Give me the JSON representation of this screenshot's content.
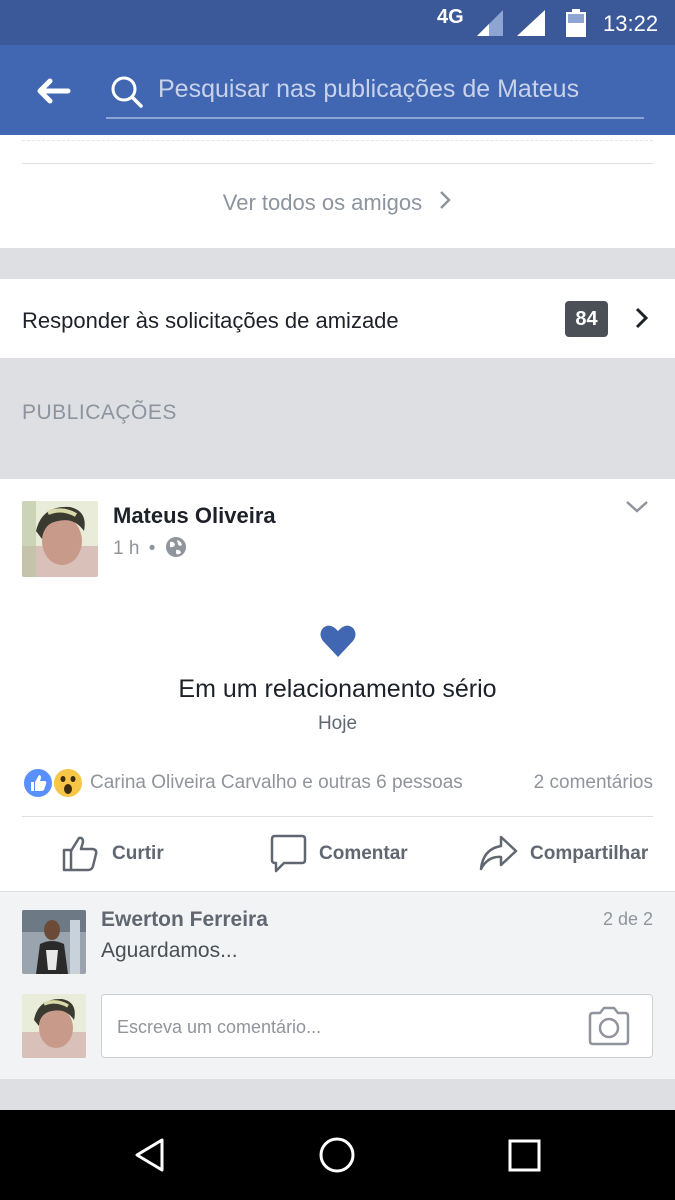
{
  "status_bar": {
    "network": "4G",
    "time": "13:22"
  },
  "header": {
    "search_placeholder": "Pesquisar nas publicações de Mateus"
  },
  "friends": {
    "see_all_label": "Ver todos os amigos"
  },
  "friend_requests": {
    "label": "Responder às solicitações de amizade",
    "count": "84"
  },
  "posts_section": {
    "title": "PUBLICAÇÕES"
  },
  "post": {
    "author": "Mateus Oliveira",
    "time": "1 h",
    "separator": "•",
    "life_event": {
      "title": "Em um relacionamento sério",
      "date": "Hoje"
    },
    "reactions_text": "Carina Oliveira Carvalho e outras 6 pessoas",
    "comments_count": "2 comentários",
    "actions": {
      "like": "Curtir",
      "comment": "Comentar",
      "share": "Compartilhar"
    }
  },
  "comments": {
    "pagination": "2 de 2",
    "items": [
      {
        "author": "Ewerton Ferreira",
        "text": "Aguardamos..."
      }
    ],
    "input_placeholder": "Escreva um comentário..."
  },
  "colors": {
    "brand": "#4267b2",
    "status_bar": "#3b5998",
    "heart": "#4267b2",
    "badge": "#4b4f56"
  },
  "icons": [
    "back-arrow-icon",
    "search-icon",
    "chevron-right-icon",
    "globe-icon",
    "chevron-down-icon",
    "heart-icon",
    "like-reaction-icon",
    "wow-reaction-icon",
    "like-icon",
    "comment-icon",
    "share-icon",
    "camera-icon",
    "nav-back-icon",
    "nav-home-icon",
    "nav-recents-icon"
  ]
}
